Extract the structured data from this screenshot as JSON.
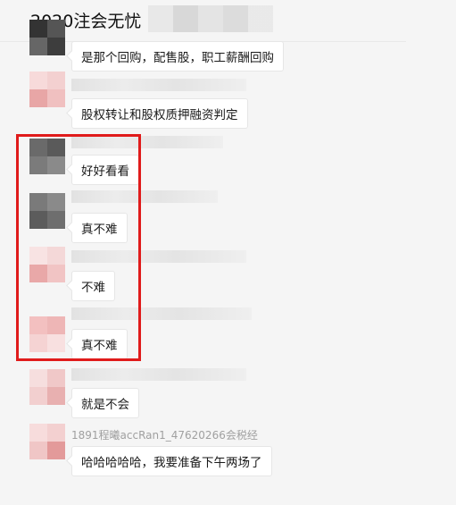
{
  "chat": {
    "title": "2020注会无忧",
    "messages": [
      {
        "sender": "",
        "text": "是那个回购，配售股，职工薪酬回购"
      },
      {
        "sender": "",
        "text": "股权转让和股权质押融资判定"
      },
      {
        "sender": "",
        "text": "好好看看"
      },
      {
        "sender": "",
        "text": "真不难"
      },
      {
        "sender": "",
        "text": "不难"
      },
      {
        "sender": "",
        "text": "真不难"
      },
      {
        "sender": "",
        "text": "就是不会"
      },
      {
        "sender": "1891程曦accRan1_47620266会税经",
        "text": "哈哈哈哈哈，我要准备下午两场了"
      }
    ]
  },
  "colors": {
    "highlight_border": "#e01b1b",
    "bubble_bg": "#ffffff",
    "window_bg": "#f5f5f5"
  }
}
